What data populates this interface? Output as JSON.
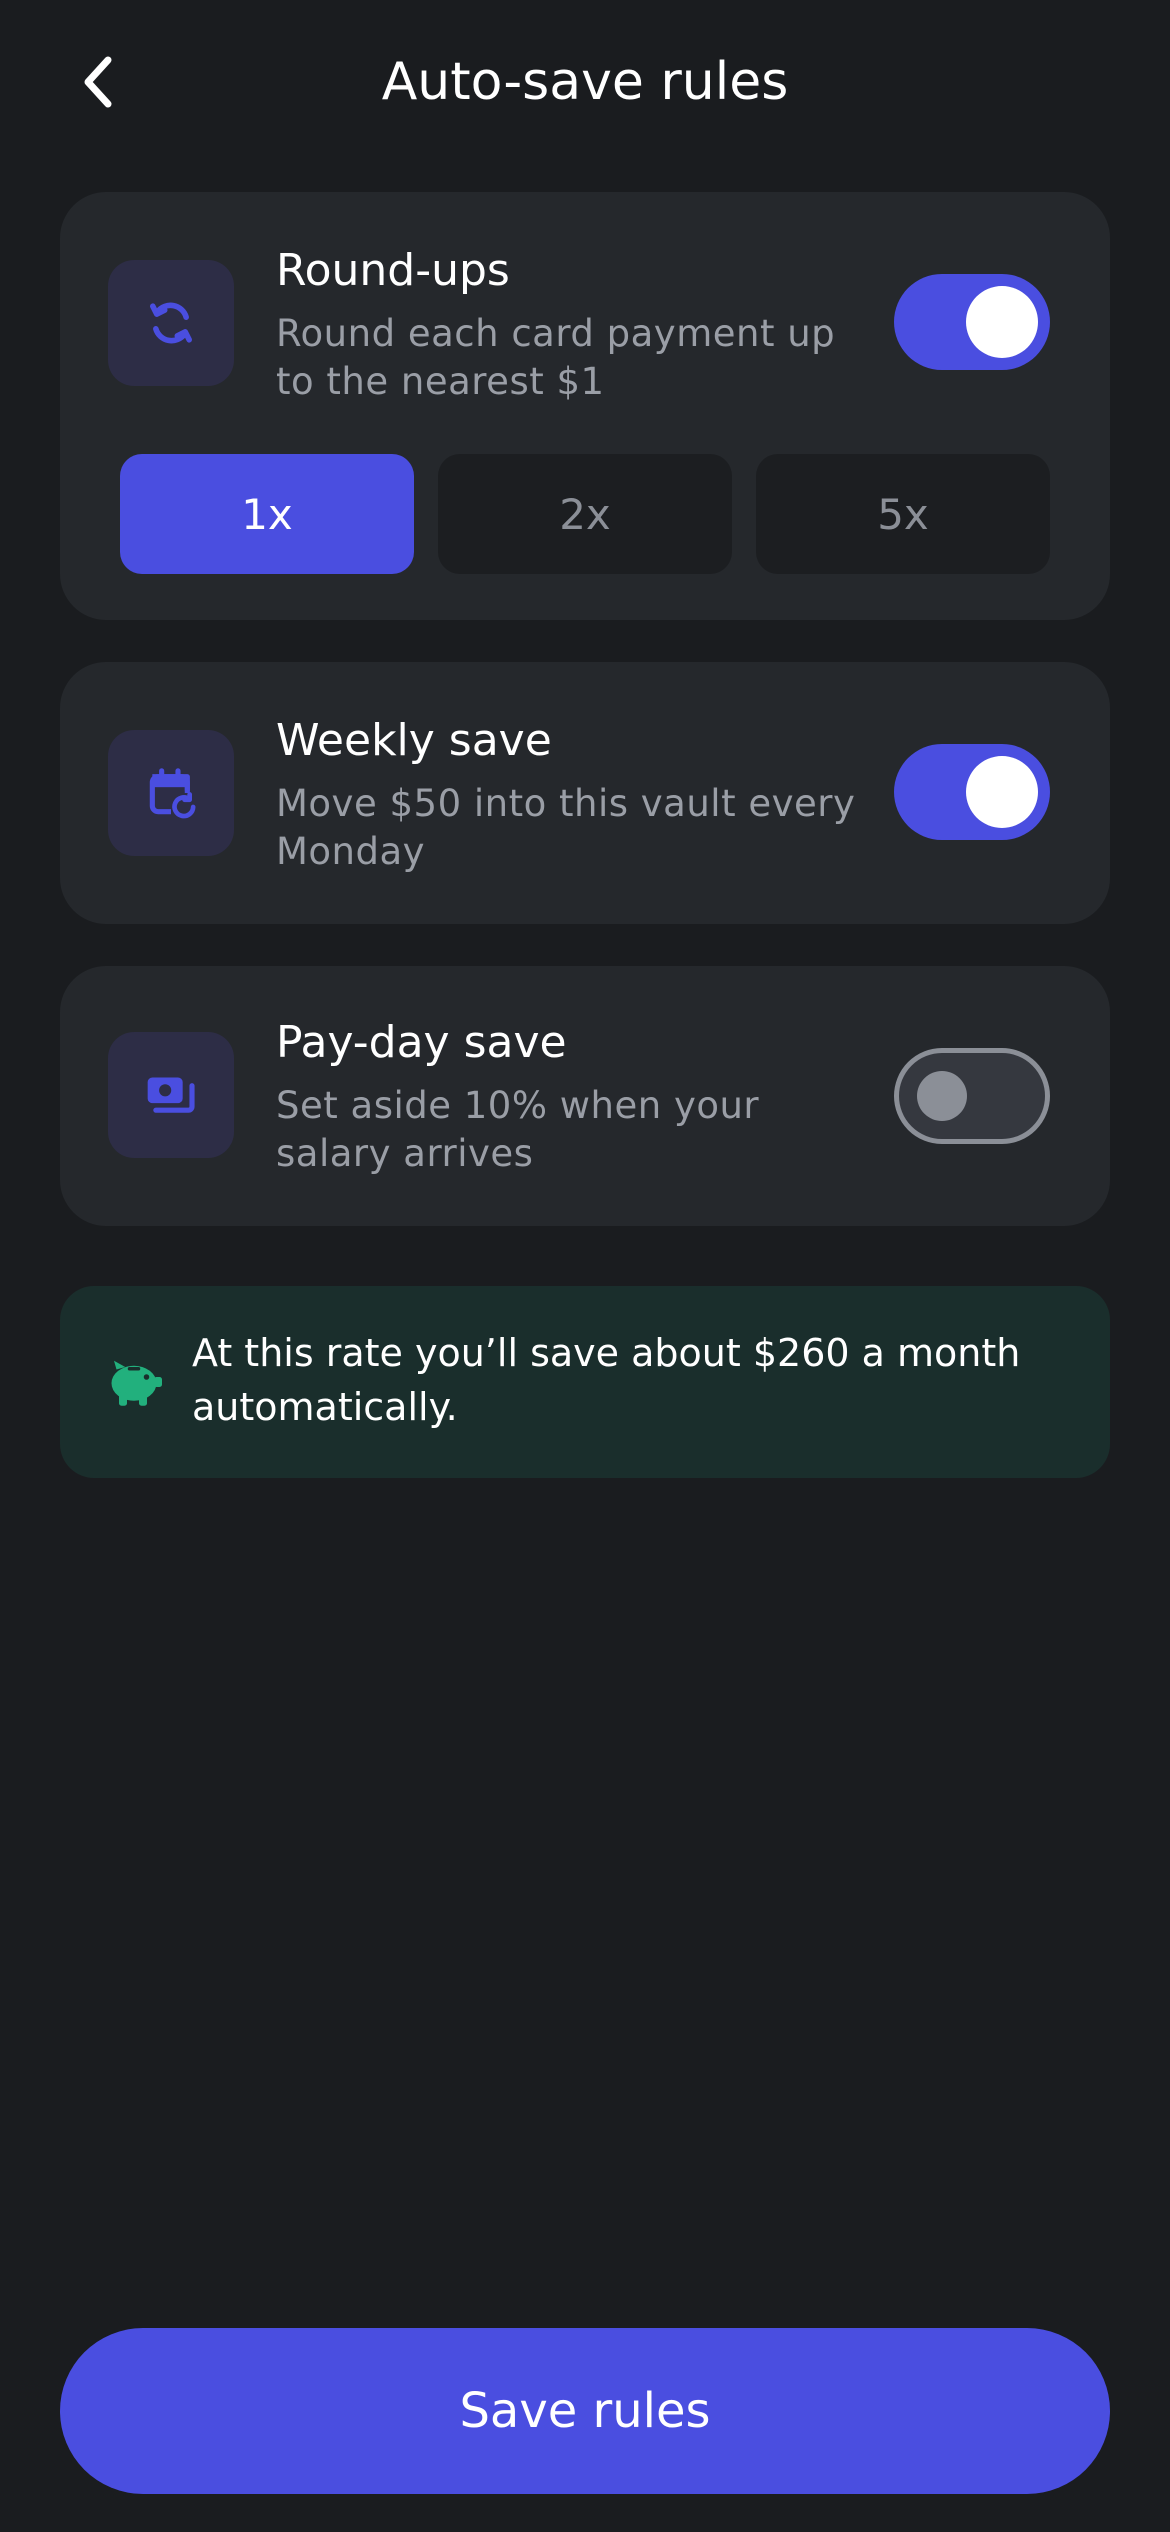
{
  "header": {
    "title": "Auto-save rules",
    "back_icon": "chevron-left-icon"
  },
  "rules": [
    {
      "title": "Round-ups",
      "description": "Round each card payment up to the nearest $1",
      "icon": "refresh-icon",
      "enabled": true
    },
    {
      "title": "Weekly save",
      "description": "Move $50 into this vault every Monday",
      "icon": "calendar-repeat-icon",
      "enabled": true
    },
    {
      "title": "Pay-day save",
      "description": "Set aside 10% when your salary arrives",
      "icon": "money-icon",
      "enabled": false
    }
  ],
  "multipliers": {
    "options": [
      "1x",
      "2x",
      "5x"
    ],
    "selected": "1x"
  },
  "info": {
    "text": "At this rate you’ll save about $260 a month automatically.",
    "icon": "piggy-bank-icon"
  },
  "footer": {
    "save_label": "Save rules"
  },
  "colors": {
    "background": "#1a1c1f",
    "card": "#25282c",
    "accent": "#4a4ee0",
    "info_background": "#1a2e2c",
    "info_icon": "#22b07d",
    "muted_text": "#9a9ea6"
  }
}
